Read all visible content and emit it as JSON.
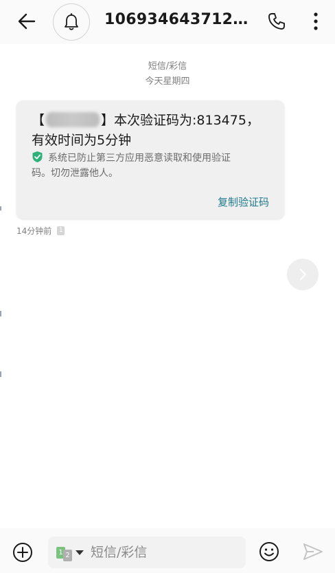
{
  "header": {
    "sender": "10693464371275...",
    "icons": {
      "back": "arrow-left-icon",
      "notify": "bell-icon",
      "call": "phone-icon",
      "more": "more-vertical-icon"
    }
  },
  "conversation": {
    "type_label": "短信/彩信",
    "date_label": "今天星期四"
  },
  "message": {
    "line1_open": "【",
    "line1_rest": "】本次验证码为:813475，",
    "line2": "有效时间为5分钟",
    "security_line1": "系统已防止第三方应用恶意读取和使用验证",
    "security_line2": "码。切勿泄露他人。",
    "copy_label": "复制验证码",
    "time": "14分钟前",
    "sim_badge": "1",
    "colors": {
      "bubble": "#f0f0f0",
      "link": "#1f7a8c",
      "shield": "#2db37a"
    }
  },
  "composer": {
    "placeholder": "短信/彩信",
    "sim_primary": "1",
    "sim_secondary": "2",
    "icons": {
      "add": "add-circle-icon",
      "emoji": "emoji-icon",
      "send": "send-icon"
    }
  }
}
